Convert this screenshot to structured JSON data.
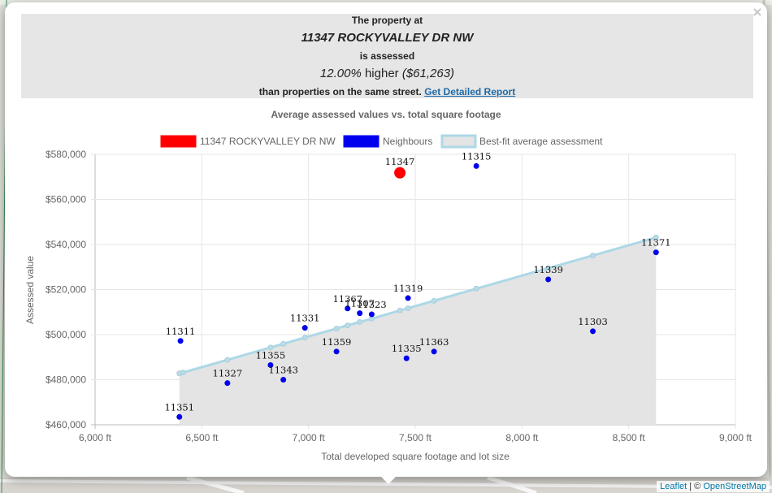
{
  "summary": {
    "line1": "The property at",
    "address": "11347 ROCKYVALLEY DR NW",
    "line3": "is assessed",
    "pct": "12.00%",
    "higher_word": "higher",
    "amount": "($61,263)",
    "line5": "than properties on the same street.",
    "link": "Get Detailed Report"
  },
  "close_label": "×",
  "attribution": {
    "leaflet": "Leaflet",
    "sep": " | © ",
    "osm": "OpenStreetMap"
  },
  "colors": {
    "subject": "#ff0000",
    "neighbours": "#0000ee",
    "fit_line": "#add8e6",
    "fit_fill": "#e4e4e4"
  },
  "chart_data": {
    "type": "scatter",
    "title": "Average assessed values vs. total square footage",
    "xlabel": "Total developed square footage and lot size",
    "ylabel": "Assessed value",
    "xlim": [
      6000,
      9000
    ],
    "ylim": [
      460000,
      580000
    ],
    "x_ticks": [
      6000,
      6500,
      7000,
      7500,
      8000,
      8500,
      9000
    ],
    "x_tick_labels": [
      "6,000 ft",
      "6,500 ft",
      "7,000 ft",
      "7,500 ft",
      "8,000 ft",
      "8,500 ft",
      "9,000 ft"
    ],
    "y_ticks": [
      460000,
      480000,
      500000,
      520000,
      540000,
      560000,
      580000
    ],
    "y_tick_labels": [
      "$460,000",
      "$480,000",
      "$500,000",
      "$520,000",
      "$540,000",
      "$560,000",
      "$580,000"
    ],
    "grid": true,
    "legend_position": "top",
    "legend": [
      {
        "label": "11347 ROCKYVALLEY DR NW",
        "kind": "subject"
      },
      {
        "label": "Neighbours",
        "kind": "neighbours"
      },
      {
        "label": "Best-fit average assessment",
        "kind": "fit"
      }
    ],
    "subject": {
      "label": "11347",
      "x": 7428,
      "y": 571800
    },
    "neighbours": [
      {
        "label": "11315",
        "x": 7786,
        "y": 574800
      },
      {
        "label": "11371",
        "x": 8628,
        "y": 536500
      },
      {
        "label": "11339",
        "x": 8123,
        "y": 524500
      },
      {
        "label": "11303",
        "x": 8332,
        "y": 501500
      },
      {
        "label": "11319",
        "x": 7466,
        "y": 516200
      },
      {
        "label": "11367",
        "x": 7183,
        "y": 511600
      },
      {
        "label": "11307",
        "x": 7240,
        "y": 509500
      },
      {
        "label": "11323",
        "x": 7296,
        "y": 509000
      },
      {
        "label": "11331",
        "x": 6983,
        "y": 503000
      },
      {
        "label": "11311",
        "x": 6400,
        "y": 497200
      },
      {
        "label": "11359",
        "x": 7131,
        "y": 492500
      },
      {
        "label": "11335",
        "x": 7459,
        "y": 489500
      },
      {
        "label": "11363",
        "x": 7588,
        "y": 492500
      },
      {
        "label": "11355",
        "x": 6822,
        "y": 486500
      },
      {
        "label": "11327",
        "x": 6620,
        "y": 478500
      },
      {
        "label": "11343",
        "x": 6882,
        "y": 480000
      },
      {
        "label": "11351",
        "x": 6395,
        "y": 463500
      }
    ],
    "fit": [
      {
        "x": 6395,
        "y": 482800
      },
      {
        "x": 6412,
        "y": 483200
      },
      {
        "x": 6620,
        "y": 488800
      },
      {
        "x": 6822,
        "y": 494300
      },
      {
        "x": 6882,
        "y": 495900
      },
      {
        "x": 6983,
        "y": 498700
      },
      {
        "x": 7131,
        "y": 502700
      },
      {
        "x": 7183,
        "y": 504100
      },
      {
        "x": 7240,
        "y": 505600
      },
      {
        "x": 7296,
        "y": 507100
      },
      {
        "x": 7428,
        "y": 510700
      },
      {
        "x": 7466,
        "y": 511700
      },
      {
        "x": 7588,
        "y": 515000
      },
      {
        "x": 7786,
        "y": 520400
      },
      {
        "x": 8123,
        "y": 529500
      },
      {
        "x": 8332,
        "y": 535100
      },
      {
        "x": 8628,
        "y": 543100
      }
    ]
  }
}
